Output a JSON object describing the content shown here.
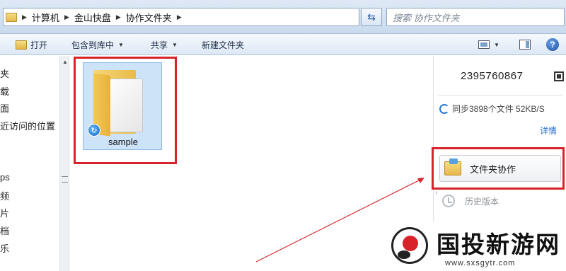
{
  "address_bar": {
    "breadcrumbs": [
      "计算机",
      "金山快盘",
      "协作文件夹"
    ],
    "search_placeholder": "搜索 协作文件夹"
  },
  "toolbar": {
    "open_label": "打开",
    "include_library_label": "包含到库中",
    "share_label": "共享",
    "new_folder_label": "新建文件夹"
  },
  "nav_pane": {
    "items": [
      "夹",
      "载",
      "面",
      "近访问的位置",
      "ps",
      "频",
      "片",
      "档",
      "乐"
    ]
  },
  "content": {
    "items": [
      {
        "name": "sample",
        "type": "folder",
        "sync_status": "synced",
        "selected": true
      }
    ]
  },
  "right_pane": {
    "account": "2395760867",
    "sync_status": "同步3898个文件 52KB/S",
    "details_link": "详情",
    "collab_button": "文件夹协作",
    "history_label": "历史版本"
  },
  "watermark": {
    "title": "国投新游网",
    "url": "www.sxsgytr.com"
  },
  "colors": {
    "highlight": "#d8232a",
    "link": "#2a6fcf",
    "selection": "#cde3f8"
  }
}
